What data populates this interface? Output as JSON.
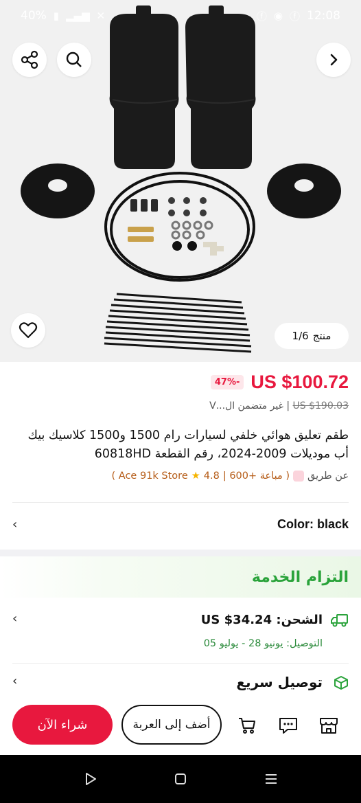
{
  "status_bar": {
    "battery": "40%",
    "time": "12:08"
  },
  "gallery": {
    "counter_label": "منتج",
    "counter_value": "1/6"
  },
  "product": {
    "price": "US $100.72",
    "discount": "47%-",
    "old_price": "US $190.03",
    "tax_note": "غير متضمن ال...V",
    "title": "طقم تعليق هوائي خلفي لسيارات رام 1500 و1500 كلاسيك بيك أب موديلات 2009-2024، رقم القطعة 60818HD",
    "seller": {
      "by": "عن طريق",
      "store_name": "Ace 91k Store",
      "rating": "4.8",
      "sold": "مباعة +600"
    },
    "color_label": "Color: black"
  },
  "service": {
    "title": "التزام الخدمة",
    "shipping": "الشحن: US $34.24",
    "delivery": "التوصيل: يونيو 28 - يوليو 05",
    "fast_delivery": "توصيل سريع"
  },
  "actions": {
    "buy_now": "شراء الآن",
    "add_to_cart": "أضف إلى العربة"
  },
  "colors": {
    "accent": "#e8183e",
    "green": "#2aa33b",
    "store": "#b55b16"
  }
}
